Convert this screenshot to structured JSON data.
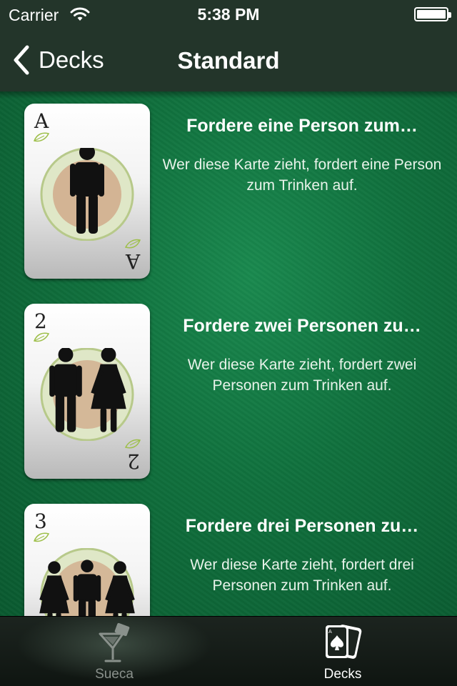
{
  "status_bar": {
    "carrier": "Carrier",
    "time": "5:38 PM"
  },
  "nav": {
    "back_label": "Decks",
    "title": "Standard"
  },
  "cards": [
    {
      "rank": "A",
      "title": "Fordere eine Person zum…",
      "description": "Wer diese Karte zieht, fordert eine Person zum Trinken auf.",
      "figures": [
        "man"
      ]
    },
    {
      "rank": "2",
      "title": "Fordere zwei Personen zu…",
      "description": "Wer diese Karte zieht, fordert zwei Personen zum Trinken auf.",
      "figures": [
        "man",
        "woman"
      ]
    },
    {
      "rank": "3",
      "title": "Fordere drei Personen zu…",
      "description": "Wer diese Karte zieht, fordert drei Personen zum Trinken auf.",
      "figures": [
        "woman",
        "man",
        "woman"
      ]
    }
  ],
  "tabs": [
    {
      "label": "Sueca",
      "icon": "cocktail-glass-icon",
      "selected": false
    },
    {
      "label": "Decks",
      "icon": "playing-cards-icon",
      "selected": true
    }
  ],
  "colors": {
    "bar": "#23352a",
    "felt": "#10703d",
    "tab_inactive": "#8a918c",
    "tab_active": "#ffffff"
  }
}
